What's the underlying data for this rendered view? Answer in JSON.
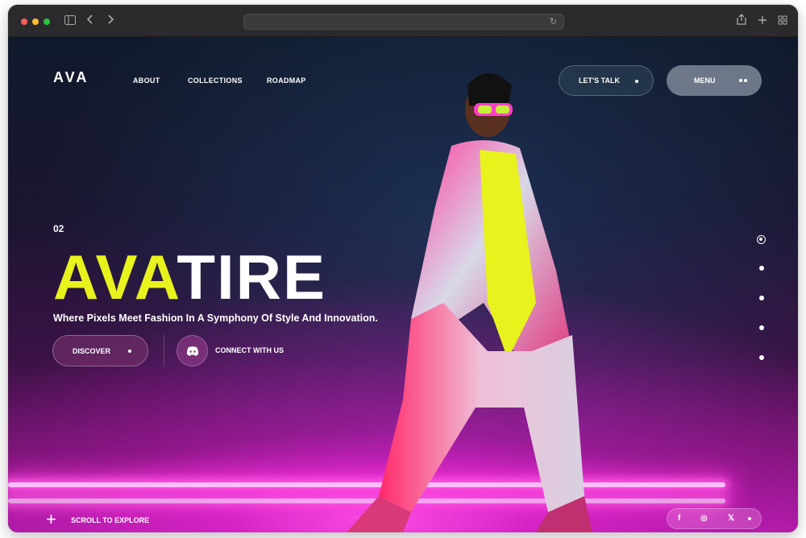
{
  "browser": {
    "sidebar_icon": "sidebar-icon",
    "back_icon": "chevron-left-icon",
    "forward_icon": "chevron-right-icon",
    "reload_icon": "reload-icon",
    "share_icon": "share-icon",
    "new_tab_icon": "plus-icon",
    "tabs_icon": "grid-icon"
  },
  "header": {
    "logo": "AVA",
    "nav": [
      "ABOUT",
      "COLLECTIONS",
      "ROADMAP"
    ],
    "talk_label": "LET'S TALK",
    "menu_label": "MENU"
  },
  "hero": {
    "index": "02",
    "title_accent": "AVA",
    "title_rest": "TIRE",
    "tagline": "Where Pixels Meet Fashion In A Symphony Of Style And Innovation.",
    "discover_label": "DISCOVER",
    "connect_label": "CONNECT WITH US"
  },
  "footer": {
    "scroll_label": "SCROLL TO EXPLORE",
    "social": [
      "f",
      "◎",
      "𝕏"
    ]
  },
  "colors": {
    "accent": "#e8f21c",
    "neon": "#ff5ce6",
    "background_top": "#101a2c",
    "background_bottom": "#b01aa8"
  }
}
